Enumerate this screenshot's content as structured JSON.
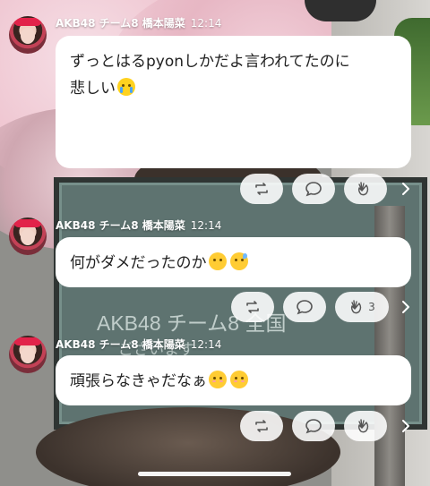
{
  "posts": [
    {
      "author": "AKB48 チーム8 橋本陽菜",
      "time": "12:14",
      "text_line1": "ずっとはるpyonしかだよ言われてたのに",
      "text_line2": "悲しい",
      "emojis": [
        "loudly-crying-face-emoji"
      ],
      "reactions": {
        "repost": "",
        "comment": "",
        "clap": ""
      }
    },
    {
      "author": "AKB48 チーム8 橋本陽菜",
      "time": "12:14",
      "text_line1": "何がダメだったのか",
      "emojis": [
        "frowning-face-emoji",
        "downcast-sweat-face-emoji"
      ],
      "reactions": {
        "repost": "",
        "comment": "",
        "clap": "3"
      }
    },
    {
      "author": "AKB48 チーム8 橋本陽菜",
      "time": "12:14",
      "text_line1": "頑張らなきゃだなぁ",
      "emojis": [
        "smiling-face-emoji",
        "smiling-face-emoji"
      ],
      "reactions": {
        "repost": "",
        "comment": "",
        "clap": ""
      }
    }
  ],
  "background_text": {
    "board_line1": "AKB48 チーム8 全国",
    "board_line2": "ございます"
  },
  "colors": {
    "bubble": "#ffffff",
    "meta_text": "#ffffff",
    "action_bg": "#ffffffe0"
  }
}
